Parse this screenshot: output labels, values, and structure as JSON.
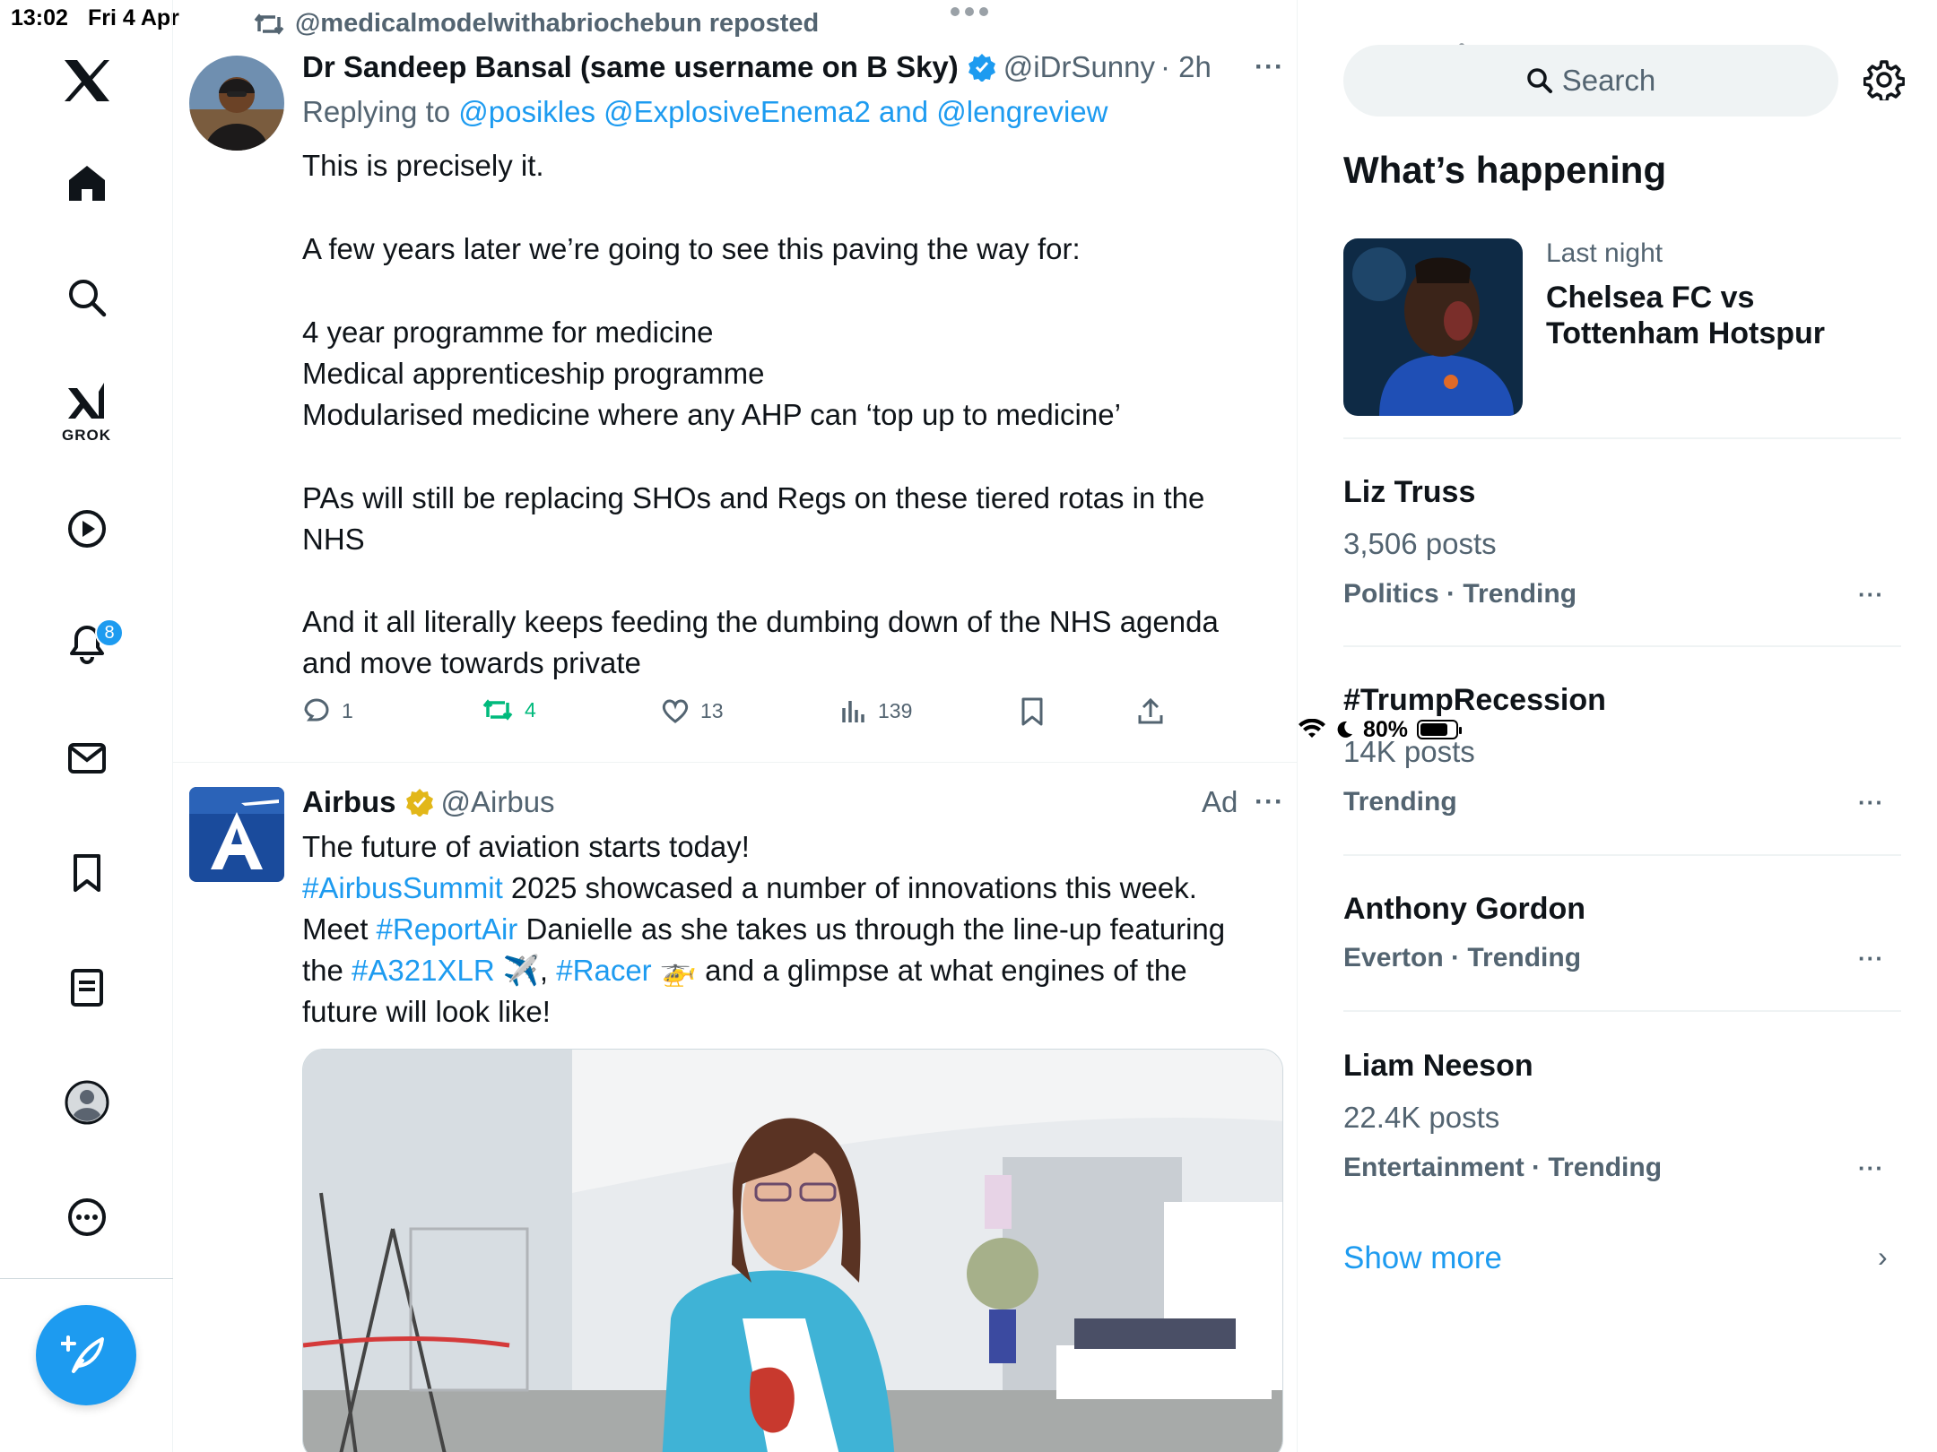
{
  "status_bar": {
    "time": "13:02",
    "date": "Fri 4 Apr",
    "battery": "80%"
  },
  "nav": {
    "grok_label": "GROK",
    "notifications_badge": "8",
    "items": [
      "home",
      "explore",
      "grok",
      "video",
      "notifications",
      "messages",
      "bookmarks",
      "lists",
      "profile",
      "more"
    ]
  },
  "tweet1": {
    "repost_text": "@medicalmodelwithabriochebun reposted",
    "author_name": "Dr Sandeep Bansal (same username on B Sky)",
    "author_handle": "@iDrSunny",
    "time": "· 2h",
    "replying_prefix": "Replying to ",
    "replying_to": [
      "@posikles",
      "@ExplosiveEnema2",
      "@lengreview"
    ],
    "replying_and": " and ",
    "body": [
      "This is precisely it.",
      "A few years later we’re going to see this paving the way for:",
      "4 year programme for medicine",
      "Medical apprenticeship programme",
      "Modularised medicine where any AHP can ‘top up to medicine’",
      "PAs will still be replacing SHOs and Regs on these tiered rotas in the",
      "NHS",
      "And it all literally keeps feeding the dumbing down of the NHS agenda",
      "and move towards private"
    ],
    "stats": {
      "replies": "1",
      "reposts": "4",
      "likes": "13",
      "views": "139"
    }
  },
  "tweet2": {
    "author_name": "Airbus",
    "author_handle": "@Airbus",
    "ad_label": "Ad",
    "logo_letter": "A",
    "line1": "The future of aviation starts today!",
    "line2_tag": "#AirbusSummit",
    "line2_rest": " 2025 showcased a number of innovations this week.",
    "line3_pre": "Meet ",
    "line3_tag": "#ReportAir",
    "line3_rest": " Danielle as she takes us through the line-up featuring",
    "line4_pre": "the ",
    "line4_tag1": "#A321XLR",
    "line4_emoji1": " ✈️, ",
    "line4_tag2": "#Racer",
    "line4_emoji2": " 🚁",
    "line4_rest": " and a glimpse at what engines of the",
    "line5": "future will look like!"
  },
  "sidebar": {
    "search_placeholder": "Search",
    "section_title": "What’s happening",
    "featured": {
      "meta": "Last night",
      "headline": "Chelsea FC vs Tottenham Hotspur"
    },
    "trends": [
      {
        "name": "Liz Truss",
        "posts": "3,506 posts",
        "category": "Politics · Trending"
      },
      {
        "name": "#TrumpRecession",
        "posts": "14K posts",
        "category": "Trending"
      },
      {
        "name": "Anthony Gordon",
        "posts": "",
        "category": "Everton · Trending"
      },
      {
        "name": "Liam Neeson",
        "posts": "22.4K posts",
        "category": "Entertainment · Trending"
      }
    ],
    "show_more": "Show more"
  },
  "colors": {
    "accent": "#1d9bf0",
    "repost_green": "#00ba7c",
    "muted": "#536471",
    "airbus_blue": "#1a4b9c"
  }
}
